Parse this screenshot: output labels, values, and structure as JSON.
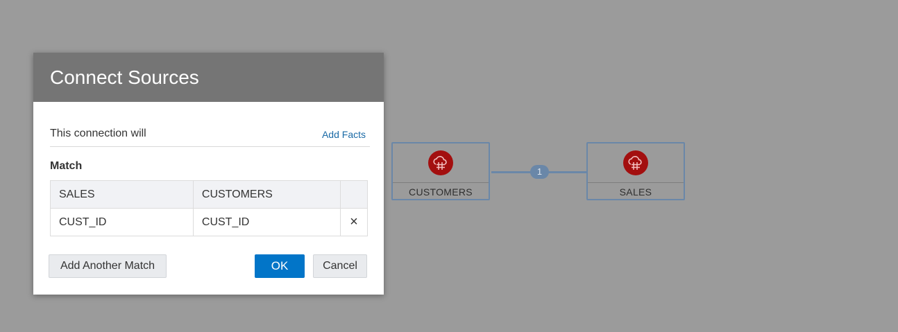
{
  "dialog": {
    "title": "Connect Sources",
    "connection_text": "This connection will",
    "add_facts_link": "Add Facts",
    "match_heading": "Match",
    "table": {
      "headers": [
        "SALES",
        "CUSTOMERS"
      ],
      "rows": [
        {
          "left": "CUST_ID",
          "right": "CUST_ID",
          "remove": "×"
        }
      ]
    },
    "buttons": {
      "add_match": "Add Another Match",
      "ok": "OK",
      "cancel": "Cancel"
    }
  },
  "diagram": {
    "nodes": [
      {
        "label": "CUSTOMERS",
        "icon": "cloud-database-icon"
      },
      {
        "label": "SALES",
        "icon": "cloud-database-icon"
      }
    ],
    "connector_badge": "1"
  },
  "colors": {
    "overlay": "#9b9b9b",
    "header": "#757575",
    "primary": "#0275c8",
    "node_border": "#6a87a8",
    "node_icon": "#a30f0f"
  }
}
